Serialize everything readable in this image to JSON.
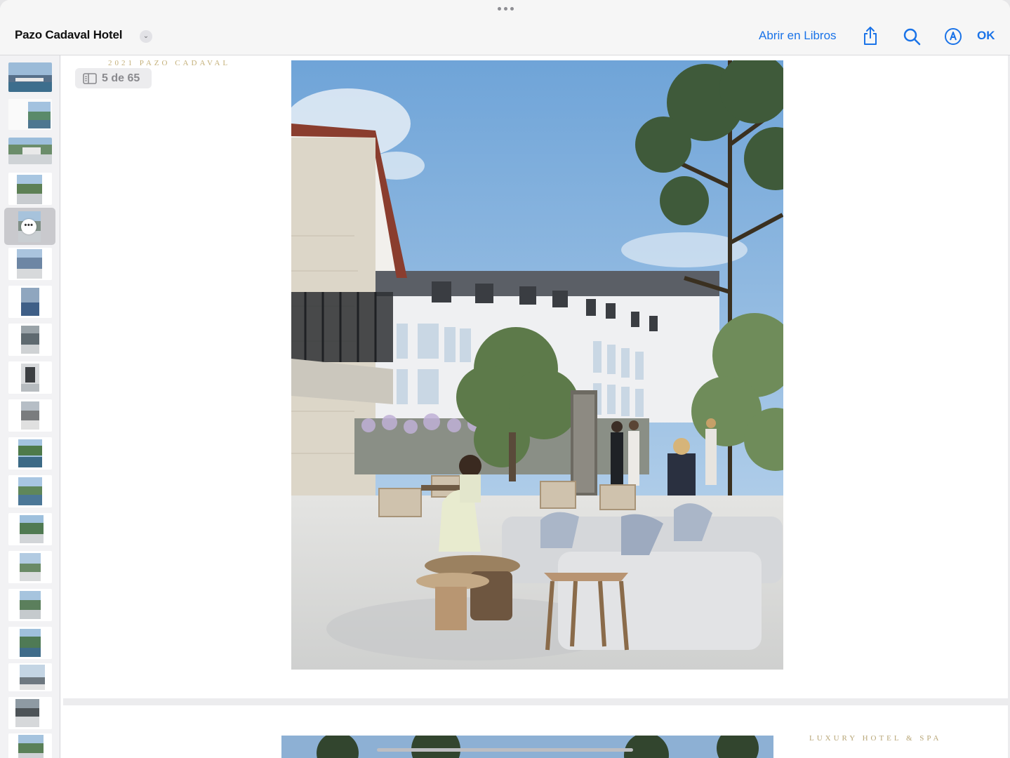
{
  "window": {
    "title": "Pazo Cadaval Hotel",
    "open_in_books": "Abrir en Libros",
    "ok": "OK"
  },
  "icons": {
    "grabber": "more-dots-icon",
    "title_menu": "chevron-down-icon",
    "share": "share-icon",
    "search": "search-icon",
    "markup": "markup-pen-icon",
    "sidebar_toggle": "sidebar-icon",
    "thumb_more": "ellipsis-icon"
  },
  "colors": {
    "accent": "#1a73e8",
    "gold_text": "#c4b07a"
  },
  "page": {
    "indicator": "5 de 65",
    "current": 5,
    "total": 65,
    "header_text": "2021 PAZO CADAVAL",
    "next_page_header": "LUXURY HOTEL & SPA"
  },
  "thumbnails": {
    "count": 19,
    "selected_index": 4
  }
}
